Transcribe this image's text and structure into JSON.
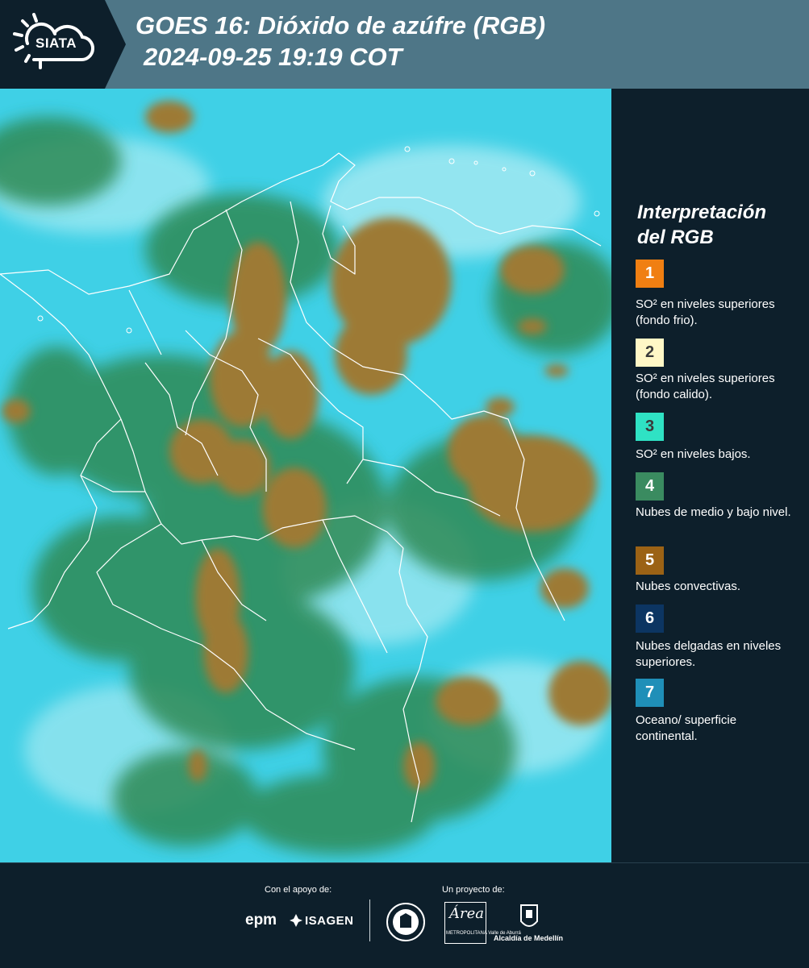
{
  "header": {
    "logo_text": "SIATA",
    "title_line1": "GOES 16: Dióxido de azúfre (RGB)",
    "title_line2": "2024-09-25 19:19 COT",
    "bg_color": "#4e7687"
  },
  "legend": {
    "title": "Interpretación del RGB",
    "items": [
      {
        "number": "1",
        "label": "SO² en niveles superiores (fondo frio).",
        "color": "#f07f12"
      },
      {
        "number": "2",
        "label": "SO² en niveles superiores (fondo calido).",
        "color": "#fff7c6"
      },
      {
        "number": "3",
        "label": "SO² en niveles bajos.",
        "color": "#2fe2c4"
      },
      {
        "number": "4",
        "label": "Nubes de medio y bajo nivel.",
        "color": "#3a8b60"
      },
      {
        "number": "5",
        "label": "Nubes convectivas.",
        "color": "#9b6215"
      },
      {
        "number": "6",
        "label": "Nubes delgadas en niveles superiores.",
        "color": "#0c3562"
      },
      {
        "number": "7",
        "label": "Oceano/ superficie continental.",
        "color": "#1f8fb8"
      }
    ]
  },
  "footer": {
    "support_label": "Con el apoyo de:",
    "project_label": "Un proyecto de:",
    "epm": "epm",
    "isagen": "ISAGEN",
    "area_script": "Área",
    "area_sub": "METROPOLITANA Valle de Aburrá",
    "alcaldia": "Alcaldía de Medellín"
  },
  "map_colors": {
    "ocean": "#3fd0e6",
    "convective": "#9d7a35",
    "midlevel": "#2f8a55",
    "border": "#ffffff"
  }
}
